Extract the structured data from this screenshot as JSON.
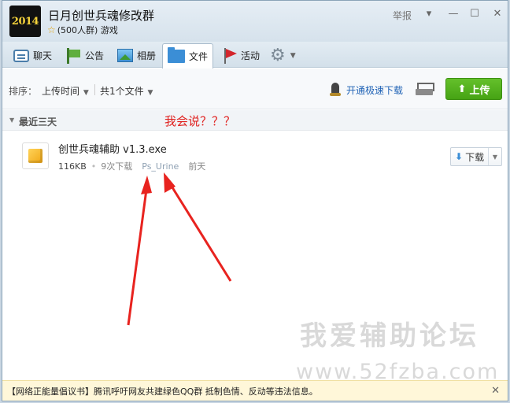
{
  "window": {
    "logo_text": "2014",
    "group_name": "日月创世兵魂修改群",
    "group_meta": "(500人群) 游戏",
    "report_label": "举报"
  },
  "tabs": [
    {
      "label": "聊天",
      "icon": "chat-icon"
    },
    {
      "label": "公告",
      "icon": "notice-icon"
    },
    {
      "label": "相册",
      "icon": "album-icon"
    },
    {
      "label": "文件",
      "icon": "file-icon",
      "active": true
    },
    {
      "label": "活动",
      "icon": "activity-icon"
    }
  ],
  "toolbar": {
    "sort_label": "排序：",
    "sort_value": "上传时间",
    "file_count": "共1个文件",
    "fast_download": "开通极速下载",
    "upload_label": "上传"
  },
  "section": {
    "title": "最近三天",
    "annotation": "我会说？？？"
  },
  "files": [
    {
      "name": "创世兵魂辅助 v1.3.exe",
      "size": "116KB",
      "downloads": "9次下载",
      "uploader": "Ps_Urine",
      "time": "前天",
      "download_label": "下载"
    }
  ],
  "watermark": {
    "title": "我爱辅助论坛",
    "url": "www.52fzba.com"
  },
  "bottom_notice": "【网络正能量倡议书】腾讯呼吁网友共建绿色QQ群 抵制色情、反动等违法信息。",
  "colors": {
    "accent": "#1f62b5",
    "upload_green": "#4fae1e",
    "annotation_red": "#e0201e"
  }
}
